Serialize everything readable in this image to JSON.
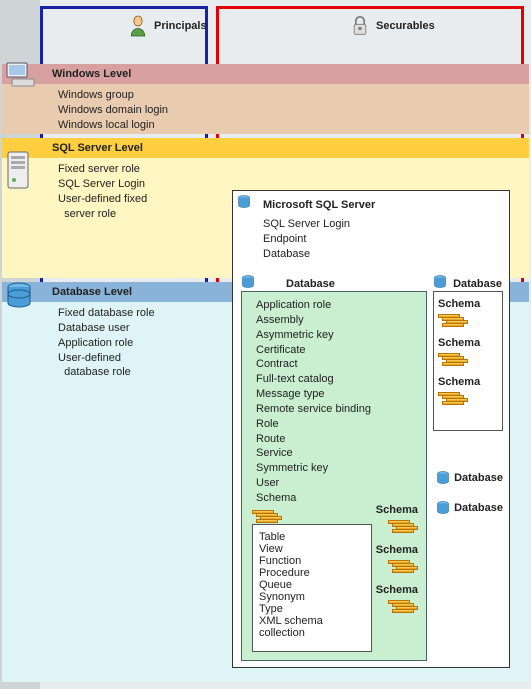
{
  "headers": {
    "principals": "Principals",
    "securables": "Securables"
  },
  "levels": {
    "windows": {
      "title": "Windows Level",
      "items": [
        "Windows group",
        "Windows domain login",
        "Windows local login"
      ]
    },
    "sql": {
      "title": "SQL Server Level",
      "items": [
        "Fixed server role",
        "SQL Server Login",
        "User-defined fixed",
        "  server role"
      ]
    },
    "db": {
      "title": "Database Level",
      "items": [
        "Fixed database role",
        "Database user",
        "Application role",
        "User-defined",
        "  database role"
      ]
    }
  },
  "sqlserver": {
    "title": "Microsoft SQL Server",
    "items": [
      "SQL Server Login",
      "Endpoint",
      "Database"
    ]
  },
  "database": {
    "title": "Database",
    "items": [
      "Application role",
      "Assembly",
      "Asymmetric key",
      "Certificate",
      "Contract",
      "Full-text catalog",
      "Message type",
      "Remote service binding",
      "Role",
      "Route",
      "Service",
      "Symmetric key",
      "User",
      "Schema"
    ],
    "schema": "Schema",
    "schema_items": [
      "Table",
      "View",
      "Function",
      "Procedure",
      "Queue",
      "Synonym",
      "Type",
      "XML schema collection"
    ]
  },
  "side_db": {
    "title": "Database",
    "schema": "Schema"
  },
  "free": {
    "db1": "Database",
    "db2": "Database"
  }
}
